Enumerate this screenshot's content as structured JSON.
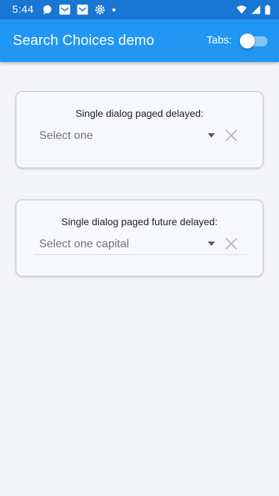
{
  "status_bar": {
    "time": "5:44",
    "icons_left": [
      "chat-bubble-icon",
      "mail-icon",
      "mail-icon",
      "gear-icon",
      "dot-icon"
    ],
    "icons_right": [
      "wifi-icon",
      "cellular-signal-icon",
      "battery-icon"
    ]
  },
  "app_bar": {
    "title": "Search Choices demo",
    "tabs_label": "Tabs:",
    "tabs_toggle_on": false
  },
  "cards": [
    {
      "label": "Single dialog paged delayed:",
      "placeholder": "Select one"
    },
    {
      "label": "Single dialog paged future delayed:",
      "placeholder": "Select one capital"
    }
  ],
  "colors": {
    "status_bar": "#1976d2",
    "app_bar": "#2196f3",
    "background": "#f4f5f7",
    "card_border": "#c8c8c8"
  }
}
